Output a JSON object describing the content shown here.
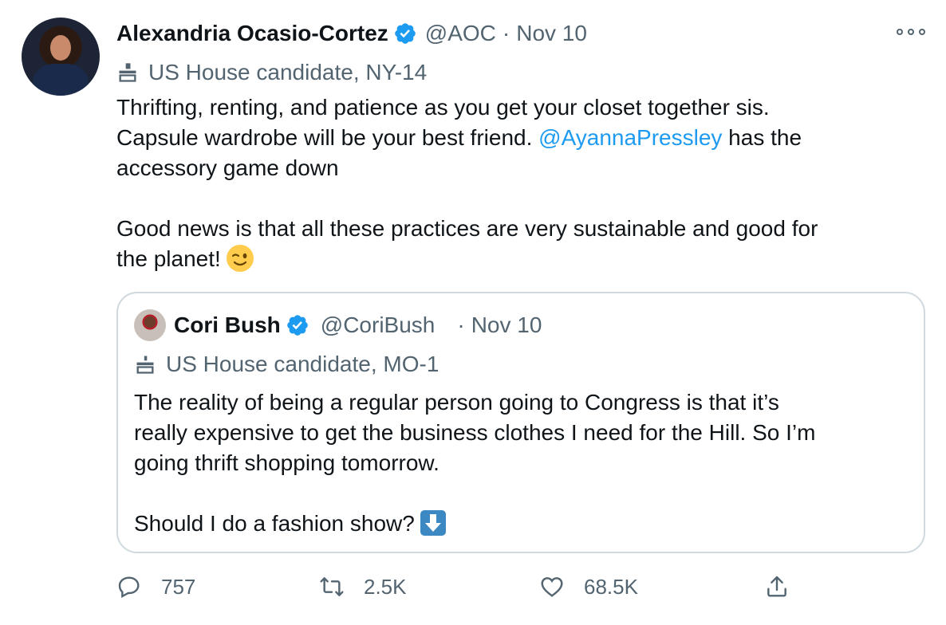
{
  "tweet": {
    "author_name": "Alexandria Ocasio-Cortez",
    "author_handle": "@AOC",
    "separator": "·",
    "date": "Nov 10",
    "label": "US House candidate, NY-14",
    "text_line1_a": "Thrifting, renting, and patience as you get your closet together sis.",
    "text_line2_a": "Capsule wardrobe will be your best friend. ",
    "mention": "@AyannaPressley",
    "text_line2_b": " has the",
    "text_line3": "accessory game down",
    "text_para2_a": "Good news is that all these practices are very sustainable and good for",
    "text_para2_b": "the planet!"
  },
  "quoted_tweet": {
    "author_name": "Cori Bush",
    "author_handle": "@CoriBush",
    "separator": "·",
    "date": "Nov 10",
    "label": "US House candidate, MO-1",
    "text_line1": "The reality of being a regular person going to Congress is that it’s",
    "text_line2": "really expensive to get the business clothes I need for the Hill. So I’m",
    "text_line3": "going thrift shopping tomorrow.",
    "text_para2": "Should I do a fashion show?"
  },
  "actions": {
    "replies": "757",
    "retweets": "2.5K",
    "likes": "68.5K"
  },
  "colors": {
    "accent": "#1d9bf0",
    "secondary_text": "#536471",
    "border": "#cfd9de"
  },
  "icons": [
    "verified-badge-icon",
    "ballot-box-icon",
    "more-options-icon",
    "reply-icon",
    "retweet-icon",
    "like-icon",
    "share-icon",
    "wink-emoji-icon",
    "down-arrow-emoji-icon"
  ]
}
